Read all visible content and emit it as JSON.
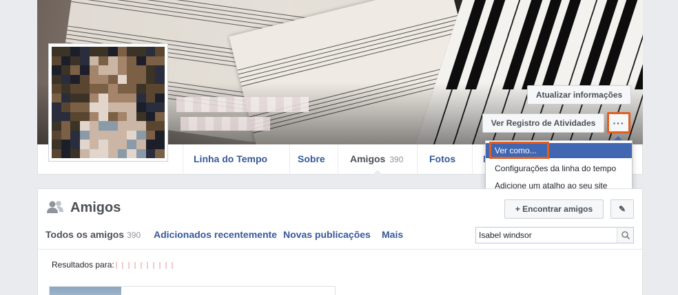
{
  "cover": {
    "update_info_label": "Atualizar informações",
    "activity_log_label": "Ver Registro de Atividades",
    "more_label": "···"
  },
  "dropdown": {
    "items": [
      "Ver como...",
      "Configurações da linha do tempo",
      "Adicione um atalho ao seu site"
    ]
  },
  "timeline_tabs": [
    {
      "label": "Linha do Tempo",
      "count": ""
    },
    {
      "label": "Sobre",
      "count": ""
    },
    {
      "label": "Amigos",
      "count": "390"
    },
    {
      "label": "Fotos",
      "count": ""
    },
    {
      "label": "M",
      "count": ""
    }
  ],
  "friends": {
    "title": "Amigos",
    "find_friends_label": "+ Encontrar amigos",
    "edit_label": "✎",
    "tabs": [
      {
        "label": "Todos os amigos",
        "count": "390"
      },
      {
        "label": "Adicionados recentemente",
        "count": ""
      },
      {
        "label": "Novas publicações",
        "count": ""
      },
      {
        "label": "Mais",
        "count": ""
      }
    ],
    "search_value": "Isabel windsor",
    "results_label": "Resultados para:"
  },
  "colors": {
    "link_blue": "#365899",
    "highlight_blue": "#4267b2",
    "annotation_orange": "#e35d1f"
  },
  "icons": {
    "friends": "friends-icon",
    "search": "search-icon",
    "edit": "pencil-icon"
  }
}
